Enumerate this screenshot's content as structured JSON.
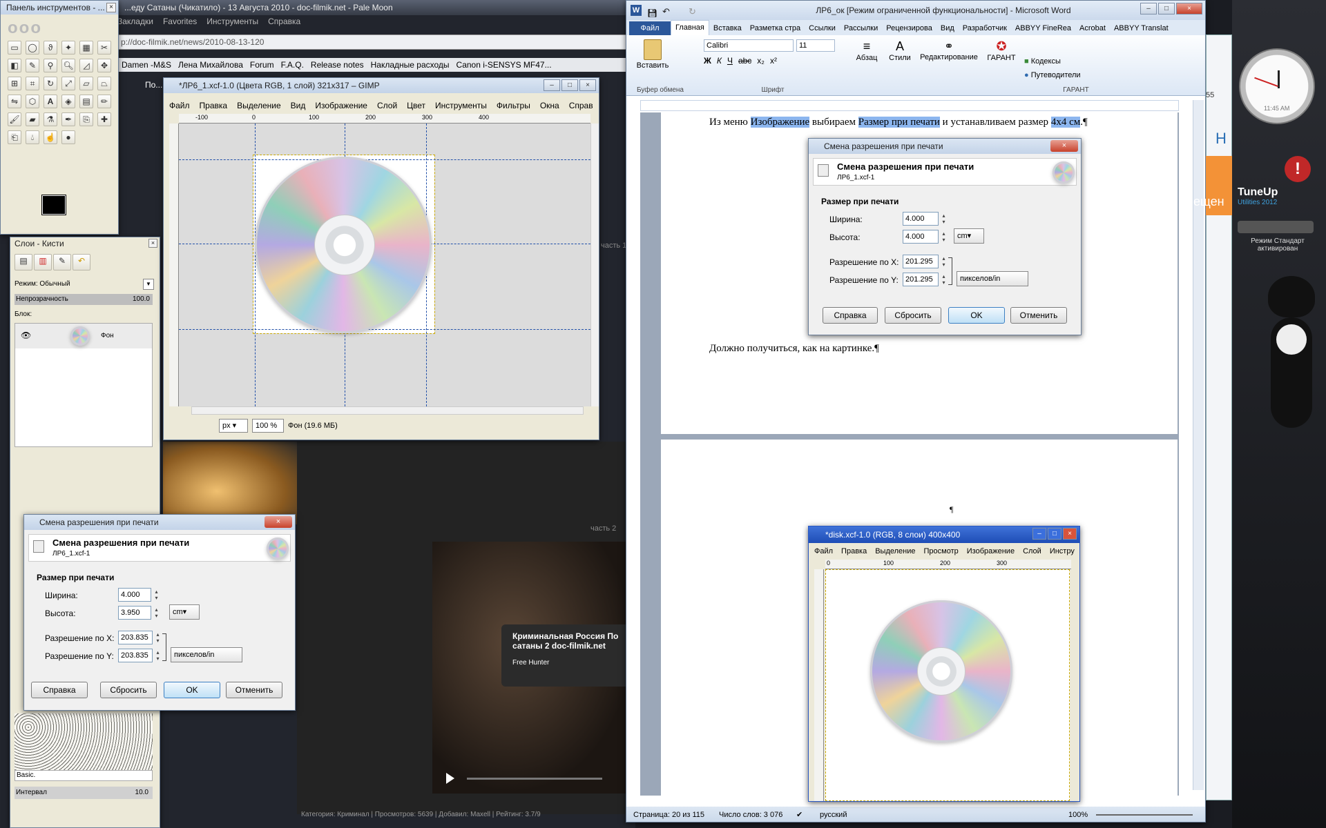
{
  "browser": {
    "title": "...еду Сатаны (Чикатило) - 13 Августа 2010 - doc-filmik.net - Pale Moon",
    "menu": [
      "Закладки",
      "Favorites",
      "Инструменты",
      "Справка"
    ],
    "url": "doc-filmik.net/news/2010-08-13-120",
    "url_prefix": "p://",
    "bookmarks": [
      "Damen -M&S",
      "Лена Михайлова",
      "Forum",
      "F.A.Q.",
      "Release notes",
      "Накладные расходы",
      "Canon i-SENSYS MF47..."
    ],
    "bookmarks_lead": "По...",
    "site_text_1": "часть 1",
    "site_text_2": "часть 2",
    "video_title": "Криминальная Россия По сатаны 2 doc-filmik.net",
    "video_channel": "Free Hunter",
    "footer": "Категория: Криминал | Просмотров: 5639 | Добавил: Maxell | Рейтинг: 3.7/9"
  },
  "gimp_toolbox": {
    "title": "Панель инструментов - ..."
  },
  "gimp_layers": {
    "title": "Слои - Кисти",
    "mode_label": "Режим:",
    "mode_value": "Обычный",
    "opacity_label": "Непрозрачность",
    "opacity_value": "100.0",
    "lock_label": "Блок:",
    "layer_name": "Фон",
    "brush_preset": "Basic.",
    "spacing_label": "Интервал",
    "spacing_value": "10.0"
  },
  "gimp_image": {
    "title": "*ЛР6_1.xcf-1.0 (Цвета RGB, 1 слой) 321x317 – GIMP",
    "menu": [
      "Файл",
      "Правка",
      "Выделение",
      "Вид",
      "Изображение",
      "Слой",
      "Цвет",
      "Инструменты",
      "Фильтры",
      "Окна",
      "Справ"
    ],
    "ruler_labels": [
      "-100",
      "0",
      "100",
      "200",
      "300",
      "400"
    ],
    "unit": "px",
    "zoom": "100 %",
    "status": "Фон (19.6 МБ)"
  },
  "dialog_front": {
    "title": "Смена разрешения при печати",
    "heading": "Смена разрешения при печати",
    "subheading": "ЛР6_1.xcf-1",
    "section": "Размер при печати",
    "width_label": "Ширина:",
    "width_value": "4.000",
    "height_label": "Высота:",
    "height_value": "3.950",
    "unit": "cm",
    "resx_label": "Разрешение по X:",
    "resx_value": "203.835",
    "resy_label": "Разрешение по Y:",
    "resy_value": "203.835",
    "res_unit": "пикселов/in",
    "btn_help": "Справка",
    "btn_reset": "Сбросить",
    "btn_ok": "OK",
    "btn_cancel": "Отменить"
  },
  "word": {
    "title": "ЛР6_ок [Режим ограниченной функциональности] - Microsoft Word",
    "tabs": [
      "Файл",
      "Главная",
      "Вставка",
      "Разметка стра",
      "Ссылки",
      "Рассылки",
      "Рецензирова",
      "Вид",
      "Разработчик",
      "ABBYY FineRea",
      "Acrobat",
      "ABBYY Translat"
    ],
    "paste_label": "Вставить",
    "clipboard_label": "Буфер обмена",
    "font_name": "Calibri",
    "font_size": "11",
    "font_group_label": "Шрифт",
    "paragraph_label": "Абзац",
    "styles_label": "Стили",
    "editing_label": "Редактирование",
    "garant_label": "ГАРАНТ",
    "codex_label": "Кодексы",
    "guides_label": "Путеводители",
    "garant_group_label": "ГАРАНТ",
    "line1_a": "Из меню ",
    "line1_hl1": "Изображение",
    "line1_b": " выбираем ",
    "line1_hl2": "Размер при печати",
    "line1_c": " и устанавливаем размер ",
    "line1_hl3": "4x4 см",
    "line1_d": ".¶",
    "line2": "Должно получиться, как на картинке.¶",
    "pilcrow": "¶",
    "status_page": "Страница: 20 из 115",
    "status_words": "Число слов: 3 076",
    "status_lang": "русский",
    "status_zoom": "100%"
  },
  "word_dialog": {
    "title": "Смена разрешения при печати",
    "heading": "Смена разрешения при печати",
    "subheading": "ЛР6_1.xcf-1",
    "section": "Размер при печати",
    "width_label": "Ширина:",
    "width_value": "4.000",
    "height_label": "Высота:",
    "height_value": "4.000",
    "unit": "cm",
    "resx_label": "Разрешение по X:",
    "resx_value": "201.295",
    "resy_label": "Разрешение по Y:",
    "resy_value": "201.295",
    "res_unit": "пикселов/in",
    "btn_help": "Справка",
    "btn_reset": "Сбросить",
    "btn_ok": "OK",
    "btn_cancel": "Отменить"
  },
  "disk_window": {
    "title": "*disk.xcf-1.0 (RGB, 8 слои) 400x400",
    "menu": [
      "Файл",
      "Правка",
      "Выделение",
      "Просмотр",
      "Изображение",
      "Слой",
      "Инстру"
    ],
    "ruler_labels": [
      "0",
      "100",
      "200",
      "300"
    ]
  },
  "desktop": {
    "clock_time": "11:45 AM",
    "tuneup_brand": "TuneUp",
    "tuneup_name": "Utilities 2012",
    "tuneup_status": "Режим Стандарт активирован",
    "side_text": "ещен",
    "side_letter": "Н",
    "side_number": "55"
  },
  "colors": {
    "word_blue": "#2b579a",
    "highlight": "#8cb6ef",
    "desktop_bg": "#1a1c22"
  }
}
